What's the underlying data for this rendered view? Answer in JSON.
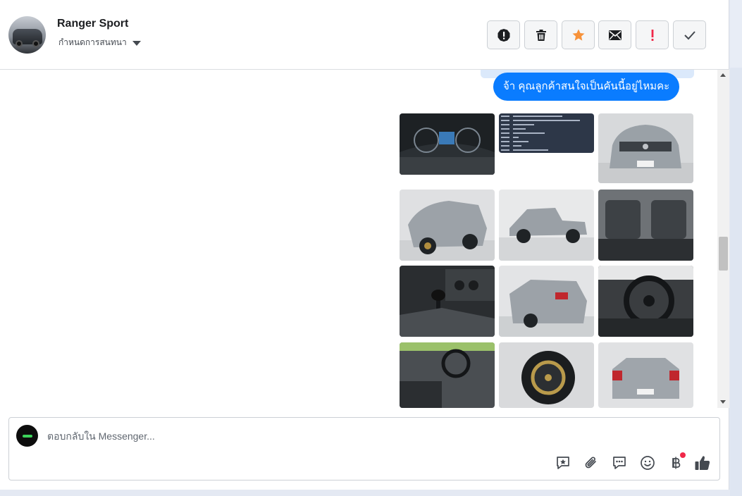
{
  "header": {
    "page_name": "Ranger Sport",
    "assign_label": "กำหนดการสนทนา",
    "actions": [
      {
        "name": "spam",
        "icon": "alert-circle-icon"
      },
      {
        "name": "delete",
        "icon": "trash-icon"
      },
      {
        "name": "star",
        "icon": "star-icon"
      },
      {
        "name": "mark-unread",
        "icon": "envelope-icon"
      },
      {
        "name": "follow-up",
        "icon": "exclamation-icon"
      },
      {
        "name": "done",
        "icon": "checkmark-icon"
      }
    ]
  },
  "conversation": {
    "last_message": "จ้า คุณลูกค้าสนใจเป็นคันนี้อยู่ไหมคะ",
    "photo_count_visible": 12
  },
  "composer": {
    "placeholder": "ตอบกลับใน Messenger...",
    "icons": [
      "saved-reply-icon",
      "attachment-icon",
      "chat-bubble-icon",
      "emoji-icon",
      "baht-payment-icon",
      "thumbs-up-icon"
    ]
  },
  "colors": {
    "accent": "#0a7cff",
    "star": "#f7923a",
    "alert": "#f02849"
  }
}
